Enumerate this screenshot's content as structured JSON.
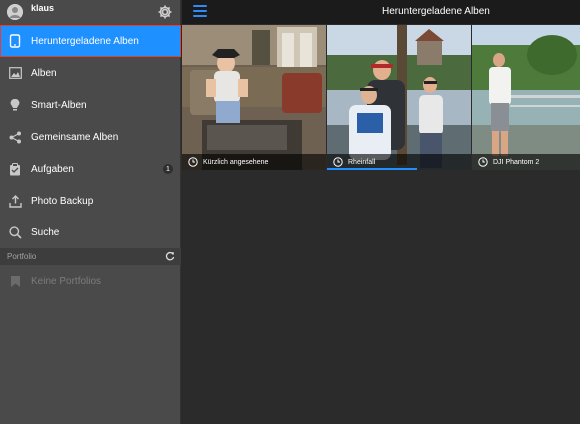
{
  "sidebar": {
    "user": {
      "name": "klaus"
    },
    "menu": [
      {
        "label": "Heruntergeladene Alben",
        "icon": "tablet-icon",
        "active": true
      },
      {
        "label": "Alben",
        "icon": "image-icon"
      },
      {
        "label": "Smart-Alben",
        "icon": "lightbulb-icon"
      },
      {
        "label": "Gemeinsame Alben",
        "icon": "share-icon"
      },
      {
        "label": "Aufgaben",
        "icon": "clipboard-icon",
        "badge": "1"
      },
      {
        "label": "Photo Backup",
        "icon": "upload-icon"
      },
      {
        "label": "Suche",
        "icon": "search-icon"
      }
    ],
    "portfolio": {
      "section_label": "Portfolio",
      "empty_label": "Keine Portfolios"
    }
  },
  "header": {
    "title": "Heruntergeladene Alben"
  },
  "albums": [
    {
      "caption": "Kürzlich angesehene"
    },
    {
      "caption": "Rheinfall"
    },
    {
      "caption": "DJI Phantom 2"
    }
  ],
  "colors": {
    "accent": "#1e90ff",
    "sidebar_bg": "#4a4a4a",
    "main_bg": "#2b2b2b",
    "topbar_bg": "#1b1b1b",
    "selection_outline": "#e0403a"
  }
}
